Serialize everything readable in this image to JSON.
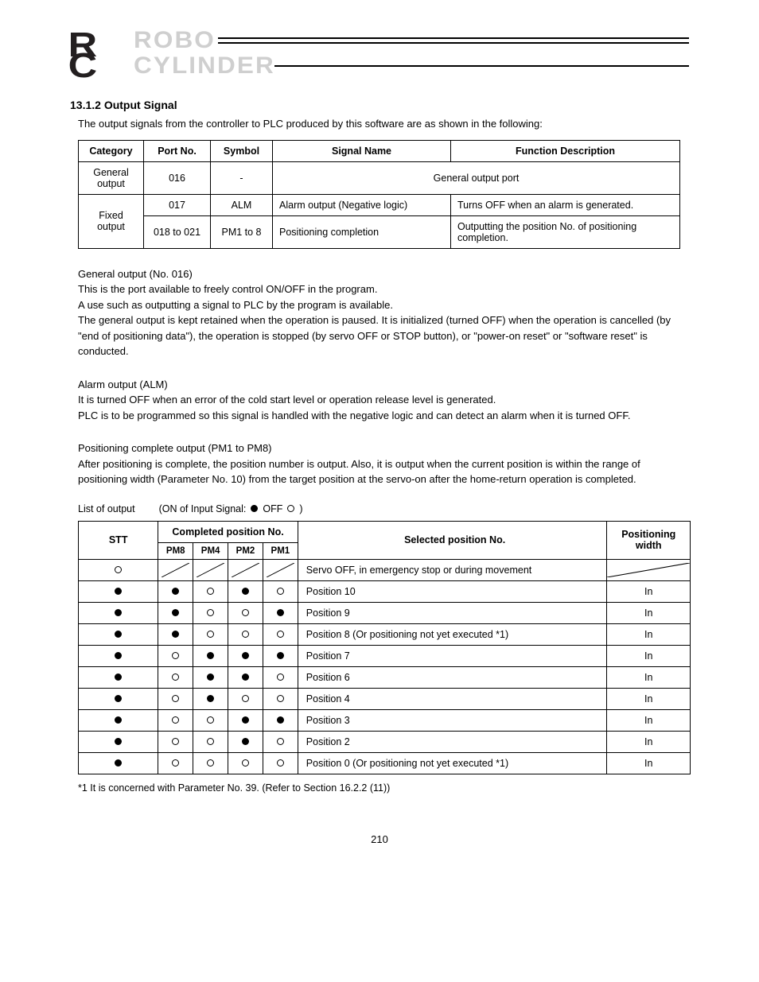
{
  "logo": {
    "word1": "ROBO",
    "word2": "CYLINDER"
  },
  "section_title": "13.1.2  Output Signal",
  "intro_para": "The output signals from the controller to PLC produced by this software are as shown in the following:",
  "table1": {
    "h1": "Category",
    "h2": "Port No.",
    "h3": "Symbol",
    "h4": "Signal Name",
    "h5": "Function Description",
    "rows": [
      {
        "cat": "General output",
        "port": "016",
        "sym": "-",
        "name_merged": "General output port",
        "desc_merged": ""
      },
      {
        "cat": "Fixed output",
        "port": "017",
        "sym": "ALM",
        "name": "Alarm output (Negative logic)",
        "desc": "Turns OFF when an alarm is generated."
      },
      {
        "cat": "",
        "port": "018 to 021",
        "sym": "PM1 to 8",
        "name": "Positioning completion",
        "desc": "Outputting the position No. of positioning completion."
      }
    ]
  },
  "general_block": {
    "heading": "General output (No. 016)",
    "text": "This is the port available to freely control ON/OFF in the program.\nA use such as outputting a signal to PLC by the program is available.\nThe general output is kept retained when the operation is paused. It is initialized (turned OFF) when the operation is cancelled (by \"end of positioning data\"), the operation is stopped (by servo OFF or STOP button), or \"power-on reset\" or \"software reset\" is conducted."
  },
  "alm_block": {
    "heading": "Alarm output (ALM)",
    "text": "It is turned OFF when an error of the cold start level or operation release level is generated.\nPLC is to be programmed so this signal is handled with the negative logic and can detect an alarm when it is turned OFF."
  },
  "pm_block": {
    "heading": "Positioning complete output (PM1 to PM8)",
    "text": "After positioning is complete, the position number is output. Also, it is output when the current position is within the range of positioning width (Parameter No. 10) from the target position at the servo-on after the home-return operation is completed."
  },
  "legend": {
    "prefix": "(ON of Input Signal:",
    "on_label": "ON",
    "off_label": "OFF",
    "suffix": ")",
    "header": "List of output"
  },
  "table2": {
    "h_stt": "STT",
    "h_pc": "Completed position No.",
    "sub": [
      "PM8",
      "PM4",
      "PM2",
      "PM1"
    ],
    "h_sel": "Selected position No.",
    "h_pw": "Positioning width",
    "rows": [
      {
        "stt": "off",
        "pm": [
          "diag",
          "diag",
          "diag",
          "diag"
        ],
        "sel": "Servo OFF, in emergency stop or during movement",
        "pw": "diag"
      },
      {
        "stt": "on",
        "pm": [
          "on",
          "off",
          "on",
          "off"
        ],
        "sel": "Position 10",
        "pw": "In"
      },
      {
        "stt": "on",
        "pm": [
          "on",
          "off",
          "off",
          "on"
        ],
        "sel": "Position 9",
        "pw": "In"
      },
      {
        "stt": "on",
        "pm": [
          "on",
          "off",
          "off",
          "off"
        ],
        "sel": "Position 8 (Or positioning not yet executed *1)",
        "pw": "In"
      },
      {
        "stt": "on",
        "pm": [
          "off",
          "on",
          "on",
          "on"
        ],
        "sel": "Position 7",
        "pw": "In"
      },
      {
        "stt": "on",
        "pm": [
          "off",
          "on",
          "on",
          "off"
        ],
        "sel": "Position 6",
        "pw": "In"
      },
      {
        "stt": "on",
        "pm": [
          "off",
          "on",
          "off",
          "off"
        ],
        "sel": "Position 4",
        "pw": "In"
      },
      {
        "stt": "on",
        "pm": [
          "off",
          "off",
          "on",
          "on"
        ],
        "sel": "Position 3",
        "pw": "In"
      },
      {
        "stt": "on",
        "pm": [
          "off",
          "off",
          "on",
          "off"
        ],
        "sel": "Position 2",
        "pw": "In"
      },
      {
        "stt": "on",
        "pm": [
          "off",
          "off",
          "off",
          "off"
        ],
        "sel": "Position 0 (Or positioning not yet executed *1)",
        "pw": "In"
      }
    ]
  },
  "footnote": "*1  It is concerned with Parameter No. 39. (Refer to Section 16.2.2 (11))",
  "page_number": "210"
}
